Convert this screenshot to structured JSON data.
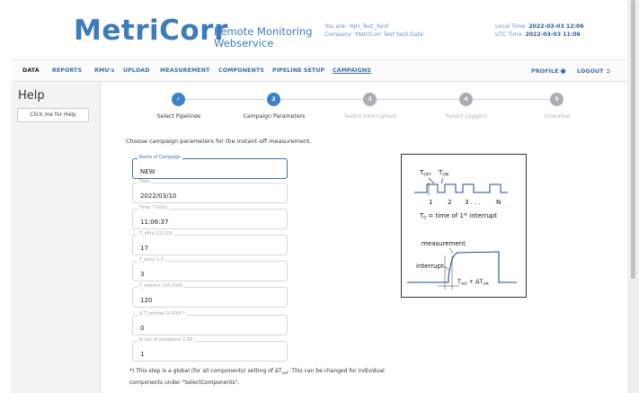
{
  "header": {
    "logo": "MetriCorr",
    "subtitle_line1": "Remote Monitoring",
    "subtitle_line2": "Webservice",
    "user_line": "You are: 'AJH_Test_Yard'",
    "company_line": "Company: 'MetriCorr Test Yard Data'",
    "local_time_label": "Local Time:",
    "local_time_value": "2022-03-03 12:06",
    "utc_time_label": "UTC Time:",
    "utc_time_value": "2022-03-03 11:06"
  },
  "nav": {
    "items": [
      {
        "label": "DATA"
      },
      {
        "label": "REPORTS"
      },
      {
        "label": "RMU's"
      },
      {
        "label": "UPLOAD"
      },
      {
        "label": "MEASUREMENT"
      },
      {
        "label": "COMPONENTS"
      },
      {
        "label": "PIPELINE SETUP"
      },
      {
        "label": "CAMPAIGNS"
      }
    ],
    "profile_label": "PROFILE",
    "logout_label": "LOGOUT"
  },
  "help": {
    "title": "Help",
    "button_label": "Click me for Help"
  },
  "stepper": {
    "steps": [
      {
        "number": "✓",
        "label": "Select Pipelines",
        "state": "done"
      },
      {
        "number": "2",
        "label": "Campaign Parameters",
        "state": "current"
      },
      {
        "number": "3",
        "label": "Select Interrupters",
        "state": "pending"
      },
      {
        "number": "4",
        "label": "Select Loggers",
        "state": "pending"
      },
      {
        "number": "5",
        "label": "Overview",
        "state": "pending"
      }
    ]
  },
  "form": {
    "intro": "Choose campaign parameters for the instant-off measurement.",
    "fields": {
      "name": {
        "label": "Name of Campaign",
        "value": "NEW"
      },
      "date": {
        "label": "Date",
        "value": "2022/03/10"
      },
      "time": {
        "label": "Time, T₀(Utc)",
        "value": "11:06:37"
      },
      "toff": {
        "label": "T_off(s) 12-119",
        "value": "17"
      },
      "ton": {
        "label": "T_on(s) 1-3",
        "value": "3"
      },
      "tset": {
        "label": "T_set(ms) 120-1000",
        "value": "120"
      },
      "dtset": {
        "label": "Δ T_set(ms) 0-2000 *",
        "value": "0"
      },
      "n": {
        "label": "N (no. of iterations) 1-30",
        "value": "1"
      }
    },
    "note_line1": "*) This step is a global (for all components) setting of ΔT",
    "note_sub": "set",
    "note_line1_end": " .This can be changed for individual",
    "note_line2": "components under \"SelectComponents\"."
  },
  "diagram": {
    "toff": "T",
    "toff_sub": "OFF",
    "ton": "T",
    "ton_sub": "ON",
    "ticks": [
      "1",
      "2",
      "3 . . .",
      "N"
    ],
    "t0_text": "T",
    "t0_sub": "0",
    "t0_rest": " = time of 1",
    "t0_sup": "st",
    "t0_end": " interrupt",
    "measurement": "measurement",
    "interrupt": "interrupt",
    "tset_label": "T",
    "tset_sub": "set",
    "tset_plus": " + ΔT",
    "tset_sub2": "set"
  },
  "colors": {
    "brand": "#3d7bbd",
    "nav_text": "#3b6ea8",
    "step_active": "#3b82c6",
    "step_inactive": "#a9adb4",
    "focus_border": "#3b70b5"
  }
}
